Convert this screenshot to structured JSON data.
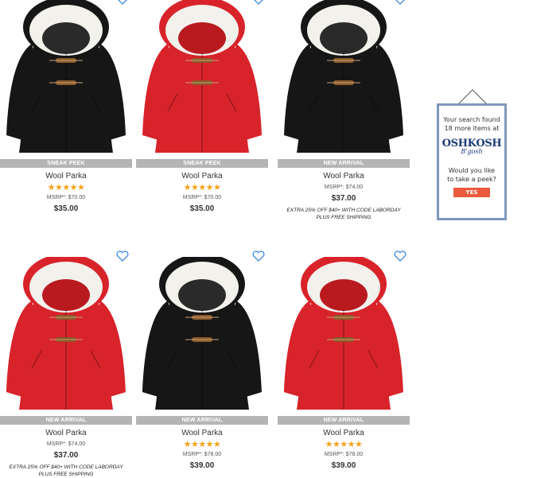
{
  "products": [
    {
      "badge": "SNEAK PEEK",
      "name": "Wool Parka",
      "has_stars": true,
      "stars": "★★★★★",
      "msrp": "MSRP*: $70.00",
      "price": "$35.00",
      "promo_line1": "",
      "promo_line2": "",
      "coat_color": "#161616"
    },
    {
      "badge": "SNEAK PEEK",
      "name": "Wool Parka",
      "has_stars": true,
      "stars": "★★★★★",
      "msrp": "MSRP*: $70.00",
      "price": "$35.00",
      "promo_line1": "",
      "promo_line2": "",
      "coat_color": "#d8232a"
    },
    {
      "badge": "NEW ARRIVAL",
      "name": "Wool Parka",
      "has_stars": false,
      "stars": "",
      "msrp": "MSRP*: $74.00",
      "price": "$37.00",
      "promo_line1": "EXTRA 25% OFF $40+ WITH CODE LABORDAY",
      "promo_line2": "PLUS FREE SHIPPING",
      "coat_color": "#161616"
    },
    {
      "badge": "NEW ARRIVAL",
      "name": "Wool Parka",
      "has_stars": false,
      "stars": "",
      "msrp": "MSRP*: $74.00",
      "price": "$37.00",
      "promo_line1": "EXTRA 25% OFF $40+ WITH CODE LABORDAY",
      "promo_line2": "PLUS FREE SHIPPING",
      "coat_color": "#d8232a"
    },
    {
      "badge": "NEW ARRIVAL",
      "name": "Wool Parka",
      "has_stars": true,
      "stars": "★★★★★",
      "msrp": "MSRP*: $78.00",
      "price": "$39.00",
      "promo_line1": "",
      "promo_line2": "",
      "coat_color": "#161616"
    },
    {
      "badge": "NEW ARRIVAL",
      "name": "Wool Parka",
      "has_stars": true,
      "stars": "★★★★★",
      "msrp": "MSRP*: $78.00",
      "price": "$39.00",
      "promo_line1": "",
      "promo_line2": "",
      "coat_color": "#d8232a"
    }
  ],
  "ad": {
    "line1": "Your search found",
    "line2": "18 more items at",
    "logo": "OSHKOSH",
    "logo_sub": "B'gosh",
    "question1": "Would you like",
    "question2": "to take a peek?",
    "yes_label": "YES",
    "border_color": "#7f97bd",
    "button_color": "#e95b3c"
  },
  "colors": {
    "badge_bg": "#b5b5b5",
    "star": "#f5a21b",
    "heart": "#4a90d9",
    "fur": "#f3f1ec",
    "toggle": "#8b5a2b"
  }
}
